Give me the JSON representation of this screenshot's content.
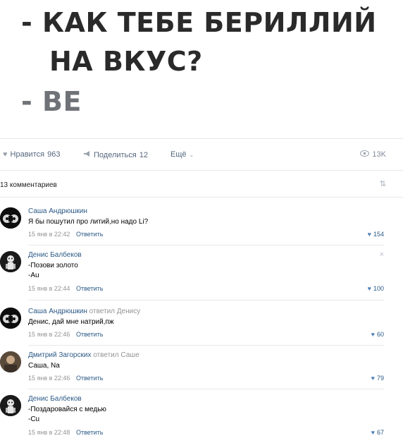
{
  "post": {
    "line1": "- КАК ТЕБЕ БЕРИЛЛИЙ",
    "line2": "НА ВКУС?",
    "line3": "- BE"
  },
  "actions": {
    "like_label": "Нравится",
    "like_count": "963",
    "share_label": "Поделиться",
    "share_count": "12",
    "more_label": "Ещё",
    "views": "13K"
  },
  "comments_header": {
    "count_label": "13 комментариев",
    "sort_icon": "sort-icon"
  },
  "comments": [
    {
      "author": "Саша Андрюшкин",
      "reply_to": "",
      "lines": [
        "Я бы пошутил про литий,но надо Li?"
      ],
      "time": "15 янв в 22:42",
      "reply_label": "Ответить",
      "likes": "154"
    },
    {
      "author": "Денис Балбеков",
      "reply_to": "",
      "lines": [
        "-Позови золото",
        "-Au"
      ],
      "time": "15 янв в 22:44",
      "reply_label": "Ответить",
      "likes": "100"
    },
    {
      "author": "Саша Андрюшкин",
      "reply_to": "ответил Денису",
      "lines": [
        "Денис, дай мне натрий,пж"
      ],
      "time": "15 янв в 22:46",
      "reply_label": "Ответить",
      "likes": "60"
    },
    {
      "author": "Дмитрий Загорских",
      "reply_to": "ответил Саше",
      "lines": [
        "Саша, Na"
      ],
      "time": "15 янв в 22:46",
      "reply_label": "Ответить",
      "likes": "79"
    },
    {
      "author": "Денис Балбеков",
      "reply_to": "",
      "lines": [
        "-Поздаровайся с медью",
        "-Cu"
      ],
      "time": "15 янв в 22:48",
      "reply_label": "Ответить",
      "likes": "67"
    }
  ],
  "colors": {
    "link": "#2a5885",
    "muted": "#939393",
    "heart": "#5181b8",
    "divider": "#e7e8ec"
  }
}
